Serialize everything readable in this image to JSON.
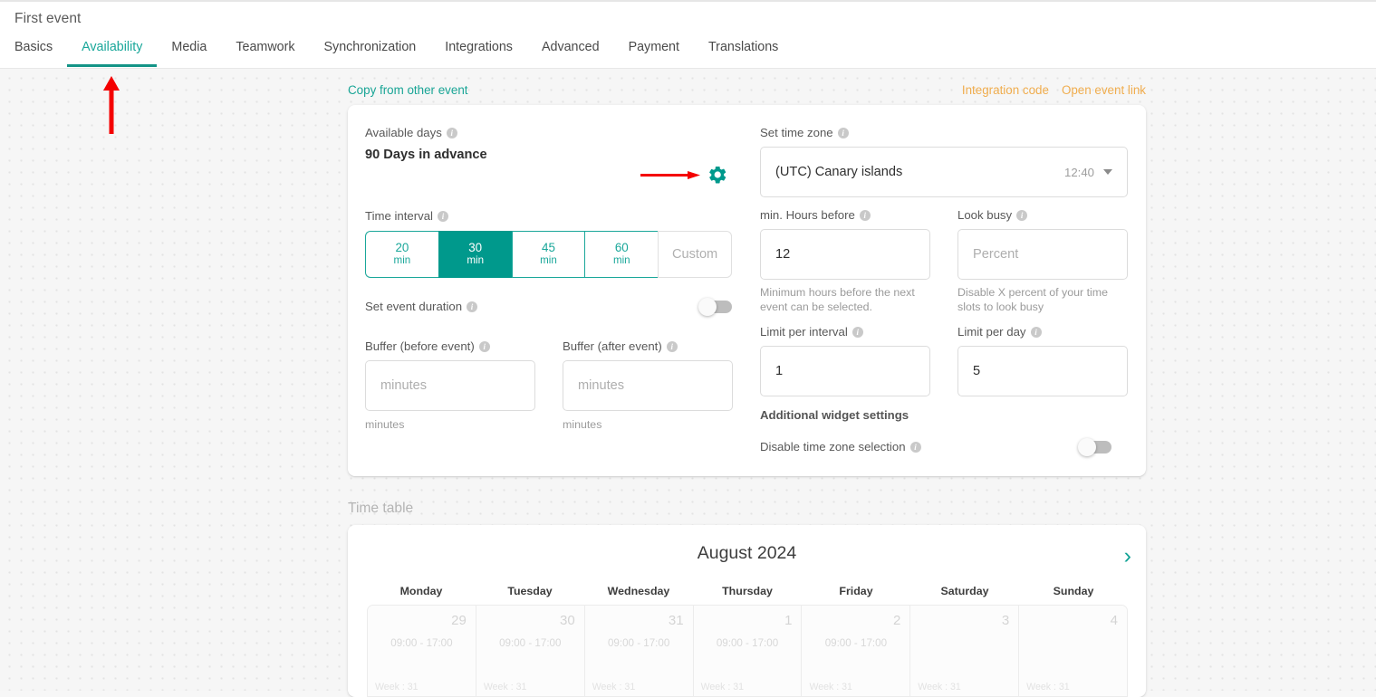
{
  "header": {
    "event_title": "First event",
    "tabs": [
      {
        "label": "Basics",
        "active": false
      },
      {
        "label": "Availability",
        "active": true
      },
      {
        "label": "Media",
        "active": false
      },
      {
        "label": "Teamwork",
        "active": false
      },
      {
        "label": "Synchronization",
        "active": false
      },
      {
        "label": "Integrations",
        "active": false
      },
      {
        "label": "Advanced",
        "active": false
      },
      {
        "label": "Payment",
        "active": false
      },
      {
        "label": "Translations",
        "active": false
      }
    ]
  },
  "links": {
    "copy_from_other_event": "Copy from other event",
    "integration_code": "Integration code",
    "open_event_link": "Open event link"
  },
  "availability": {
    "available_days": {
      "label": "Available days",
      "value": "90 Days in advance",
      "gear_icon": "gear-icon"
    },
    "time_interval": {
      "label": "Time interval",
      "options": [
        {
          "value": "20",
          "unit": "min",
          "selected": false
        },
        {
          "value": "30",
          "unit": "min",
          "selected": true
        },
        {
          "value": "45",
          "unit": "min",
          "selected": false
        },
        {
          "value": "60",
          "unit": "min",
          "selected": false
        }
      ],
      "custom_label": "Custom"
    },
    "set_event_duration": {
      "label": "Set event duration",
      "enabled": false
    },
    "buffer_before": {
      "label": "Buffer (before event)",
      "value": "",
      "placeholder": "minutes",
      "helper": "minutes"
    },
    "buffer_after": {
      "label": "Buffer (after event)",
      "value": "",
      "placeholder": "minutes",
      "helper": "minutes"
    },
    "time_zone": {
      "label": "Set time zone",
      "value": "(UTC) Canary islands",
      "current_time": "12:40"
    },
    "min_hours_before": {
      "label": "min. Hours before",
      "value": "12",
      "helper": "Minimum hours before the next event can be selected."
    },
    "look_busy": {
      "label": "Look busy",
      "value": "",
      "placeholder": "Percent",
      "helper": "Disable X percent of your time slots to look busy"
    },
    "limit_per_interval": {
      "label": "Limit per interval",
      "value": "1"
    },
    "limit_per_day": {
      "label": "Limit per day",
      "value": "5"
    },
    "additional_widget_settings": "Additional widget settings",
    "disable_time_zone_selection": {
      "label": "Disable time zone selection",
      "enabled": false
    }
  },
  "time_table": {
    "title": "Time table",
    "month": "August 2024",
    "next_icon": "chevron-right-icon",
    "weekdays": [
      "Monday",
      "Tuesday",
      "Wednesday",
      "Thursday",
      "Friday",
      "Saturday",
      "Sunday"
    ],
    "days": [
      {
        "number": "29",
        "hours": "09:00 - 17:00",
        "week": "Week : 31"
      },
      {
        "number": "30",
        "hours": "09:00 - 17:00",
        "week": "Week : 31"
      },
      {
        "number": "31",
        "hours": "09:00 - 17:00",
        "week": "Week : 31"
      },
      {
        "number": "1",
        "hours": "09:00 - 17:00",
        "week": "Week : 31"
      },
      {
        "number": "2",
        "hours": "09:00 - 17:00",
        "week": "Week : 31"
      },
      {
        "number": "3",
        "hours": "",
        "week": "Week : 31"
      },
      {
        "number": "4",
        "hours": "",
        "week": "Week : 31"
      }
    ]
  },
  "annotations": {
    "arrow_tab_color": "#f40000",
    "arrow_gear_color": "#f40000"
  },
  "colors": {
    "accent_teal": "#00998c",
    "link_orange": "#f0ad4e",
    "page_bg": "#f6f6f6"
  }
}
